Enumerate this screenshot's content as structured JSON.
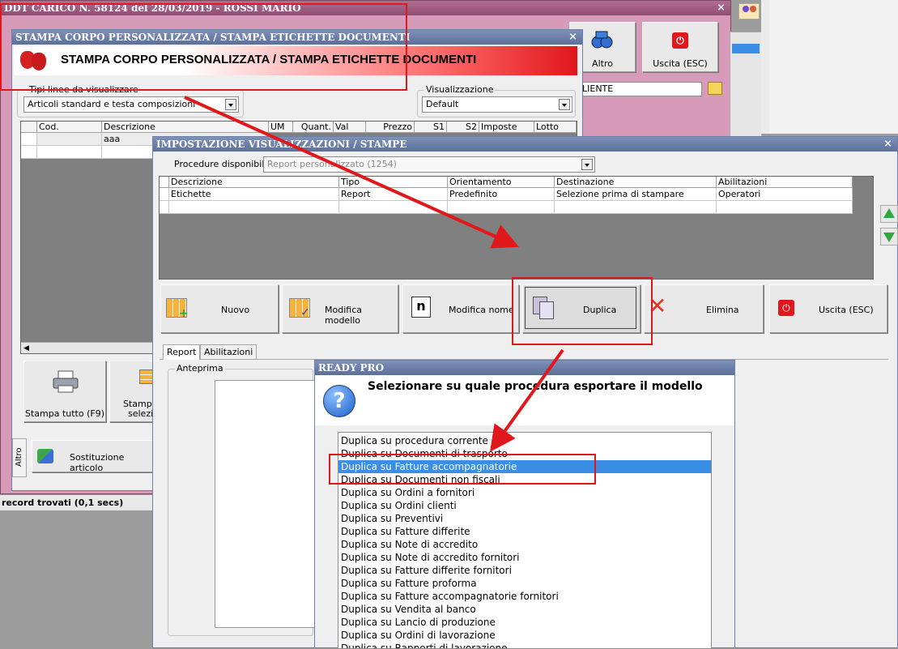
{
  "ddt_window": {
    "title": "DDT CARICO N. 58124 del 28/03/2019 - ROSSI MARIO",
    "altro_label": "Altro",
    "uscita_label": "Uscita (ESC)",
    "cliente_label": "LIENTE",
    "status_text": "record trovati (0,1 secs)"
  },
  "stampa_window": {
    "titlebar": "STAMPA CORPO PERSONALIZZATA / STAMPA ETICHETTE DOCUMENTI",
    "banner_title": "STAMPA CORPO PERSONALIZZATA / STAMPA ETICHETTE DOCUMENTI",
    "tipi_label": "Tipi linee da visualizzare",
    "tipi_value": "Articoli standard e testa composizioni",
    "visualizzazione_label": "Visualizzazione",
    "visualizzazione_value": "Default",
    "grid_headers": [
      "Cod.",
      "Descrizione",
      "UM",
      "Quant.",
      "Val",
      "Prezzo",
      "S1",
      "S2",
      "Imposte",
      "Lotto"
    ],
    "grid_row_descr": "aaa",
    "stampa_tutto_label": "Stampa tutto (F9)",
    "stampa_sel_label_1": "Stampa",
    "stampa_sel_label_2": "selezio",
    "altro_vert_tab": "Altro",
    "sostituzione_label": "Sostituzione articolo"
  },
  "impostazione_window": {
    "title": "IMPOSTAZIONE VISUALIZZAZIONI / STAMPE",
    "procedure_label": "Procedure disponibili :",
    "procedure_value": "Report personalizzato (1254)",
    "table_headers": [
      "Descrizione",
      "Tipo",
      "Orientamento",
      "Destinazione",
      "Abilitazioni"
    ],
    "table_row": [
      "Etichette",
      "Report",
      "Predefinito",
      "Selezione prima di stampare",
      "Operatori"
    ],
    "buttons": {
      "nuovo": "Nuovo",
      "modifica_modello": "Modifica modello",
      "modifica_nome": "Modifica nome",
      "duplica": "Duplica",
      "elimina": "Elimina",
      "uscita": "Uscita (ESC)"
    },
    "tabs": [
      "Report",
      "Abilitazioni"
    ],
    "anteprima_label": "Anteprima"
  },
  "ready_dialog": {
    "title": "READY PRO",
    "question": "Selezionare su quale procedura esportare il modello",
    "items": [
      "Duplica su procedura corrente (",
      "Duplica su Documenti di trasporto",
      "Duplica su Fatture accompagnatorie",
      "Duplica su Documenti non fiscali",
      "Duplica su Ordini a fornitori",
      "Duplica su Ordini clienti",
      "Duplica su Preventivi",
      "Duplica su Fatture differite",
      "Duplica su Note di accredito",
      "Duplica su Note di accredito fornitori",
      "Duplica su Fatture differite fornitori",
      "Duplica su Fatture proforma",
      "Duplica su Fatture accompagnatorie fornitori",
      "Duplica su Vendita al banco",
      "Duplica su Lancio di produzione",
      "Duplica su Ordini di lavorazione",
      "Duplica su Rapporti di lavorazione"
    ],
    "selected_index": 2
  },
  "colors": {
    "accent_red": "#e0171b",
    "selection_blue": "#3a8ee6",
    "ddt_pink": "#d79ab8"
  },
  "icons": [
    "strawberry-icon",
    "printer-icon",
    "grid-add-icon",
    "grid-check-icon",
    "n-letter-icon",
    "copy-icon",
    "red-x-icon",
    "exit-icon",
    "question-icon",
    "arrow-up-icon",
    "arrow-down-icon",
    "folder-icon",
    "binoculars-icon",
    "users-icon"
  ]
}
